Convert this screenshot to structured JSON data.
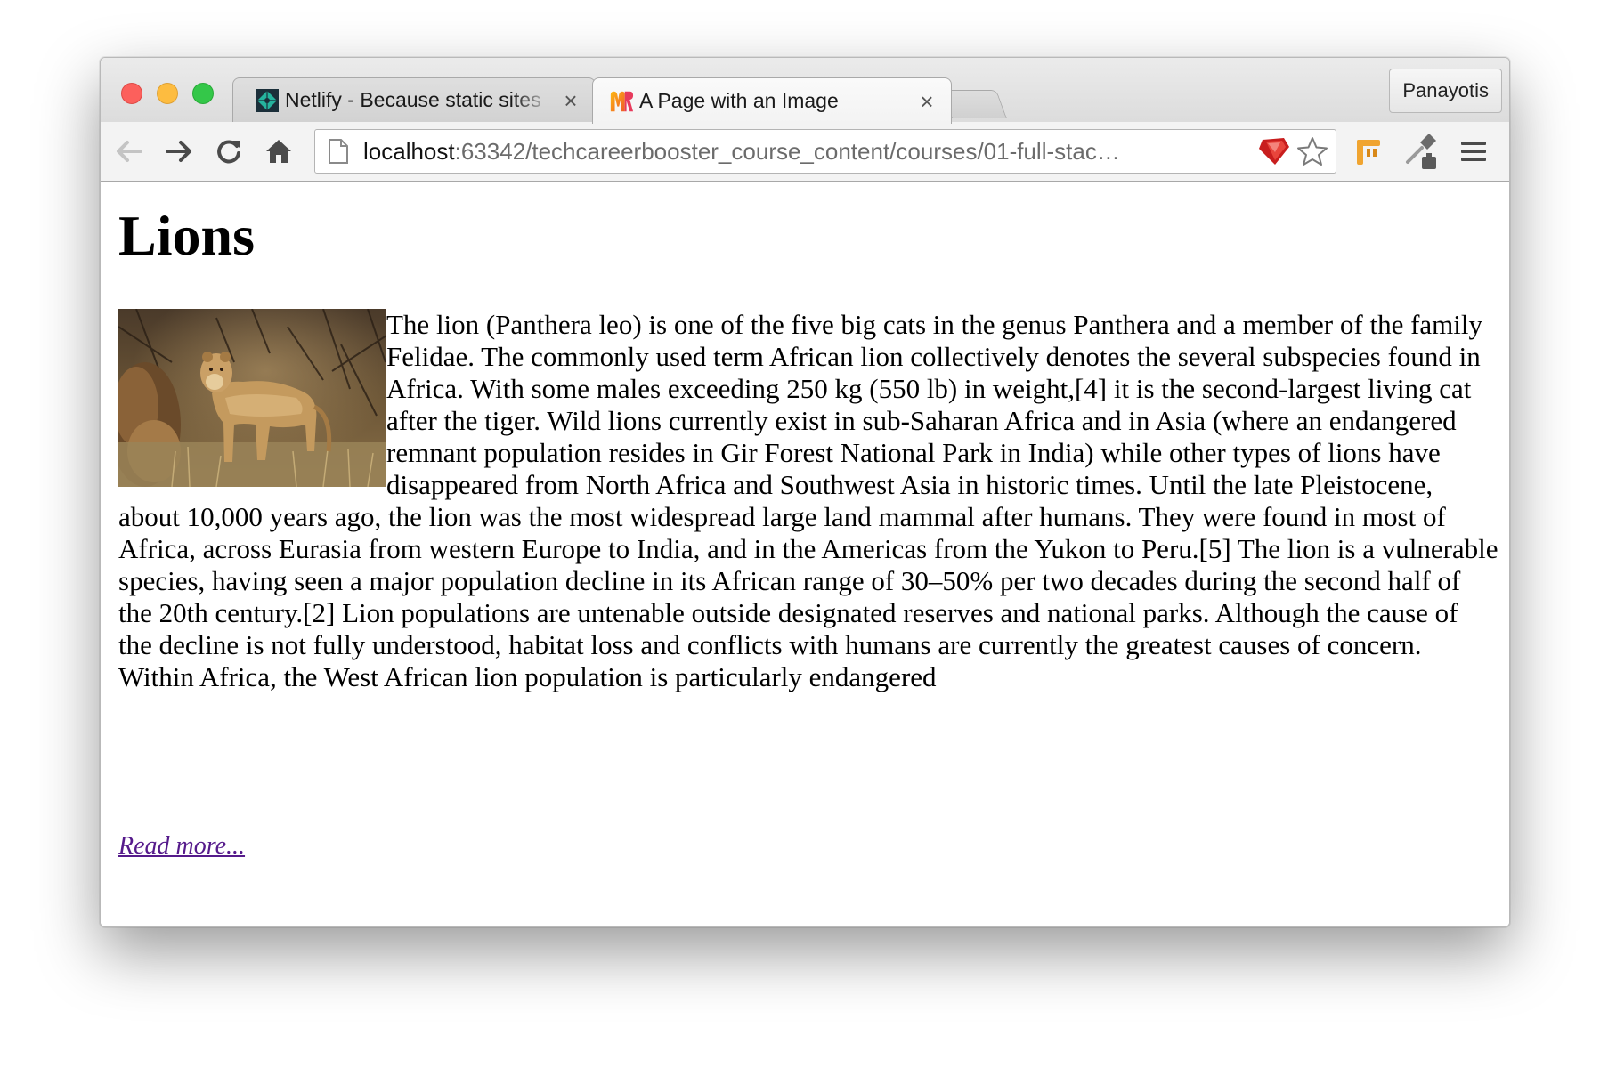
{
  "browser": {
    "tabs": [
      {
        "title": "Netlify - Because static sites",
        "favicon": "netlify-icon",
        "active": false
      },
      {
        "title": "A Page with an Image",
        "favicon": "rubymine-icon",
        "active": true
      }
    ],
    "tab_close_glyph": "×",
    "profile_name": "Panayotis",
    "address": {
      "host": "localhost",
      "rest": ":63342/techcareerbooster_course_content/courses/01-full-stac…"
    },
    "toolbar_icons": [
      "back-arrow-icon",
      "forward-arrow-icon",
      "reload-icon",
      "home-icon",
      "page-icon",
      "ruby-extension-icon",
      "bookmark-star-icon",
      "pin-extension-icon",
      "eyedropper-extension-icon",
      "menu-icon"
    ],
    "colors": {
      "close": "#fc605c",
      "minimize": "#fdbc40",
      "maximize": "#34c749",
      "visited_link": "#551a8b"
    }
  },
  "page": {
    "heading": "Lions",
    "image_alt": "lioness standing in dry grassland",
    "paragraph": "The lion (Panthera leo) is one of the five big cats in the genus Panthera and a member of the family Felidae. The commonly used term African lion collectively denotes the several subspecies found in Africa. With some males exceeding 250 kg (550 lb) in weight,[4] it is the second-largest living cat after the tiger. Wild lions currently exist in sub-Saharan Africa and in Asia (where an endangered remnant population resides in Gir Forest National Park in India) while other types of lions have disappeared from North Africa and Southwest Asia in historic times. Until the late Pleistocene, about 10,000 years ago, the lion was the most widespread large land mammal after humans. They were found in most of Africa, across Eurasia from western Europe to India, and in the Americas from the Yukon to Peru.[5] The lion is a vulnerable species, having seen a major population decline in its African range of 30–50% per two decades during the second half of the 20th century.[2] Lion populations are untenable outside designated reserves and national parks. Although the cause of the decline is not fully understood, habitat loss and conflicts with humans are currently the greatest causes of concern. Within Africa, the West African lion population is particularly endangered",
    "read_more": "Read more..."
  }
}
